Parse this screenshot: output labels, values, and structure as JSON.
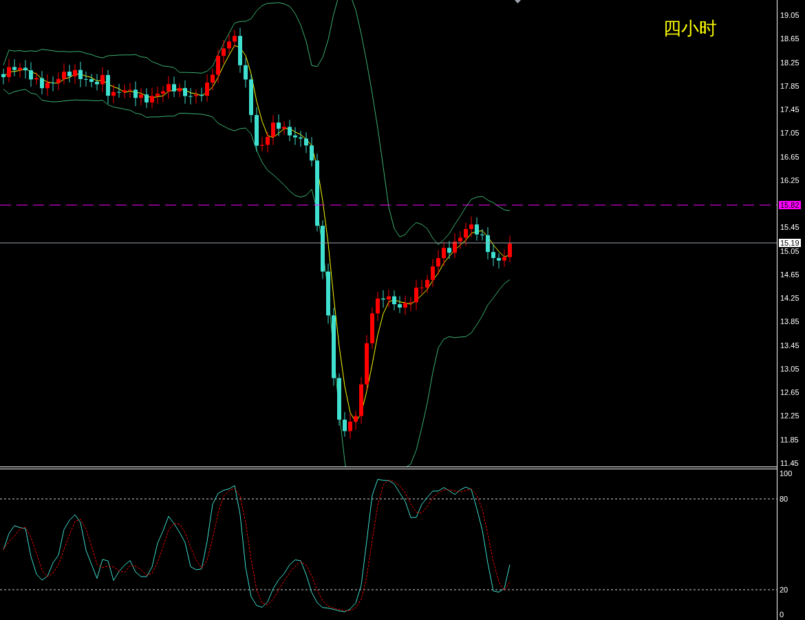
{
  "chart_title": "四小时",
  "price_axis": {
    "labels": [
      "19.05",
      "18.65",
      "18.25",
      "17.85",
      "17.45",
      "17.05",
      "16.65",
      "16.25",
      "15.45",
      "15.05",
      "14.65",
      "14.25",
      "13.85",
      "13.45",
      "13.05",
      "12.65",
      "12.25",
      "11.85",
      "11.45"
    ]
  },
  "price_markers": [
    {
      "kind": "alert",
      "label": "15.82",
      "color": "#ff00ff"
    },
    {
      "kind": "last",
      "label": "15.19",
      "color": "#ffffff"
    }
  ],
  "oscillator_axis": {
    "labels": [
      "100",
      "80",
      "20",
      "0"
    ]
  }
}
